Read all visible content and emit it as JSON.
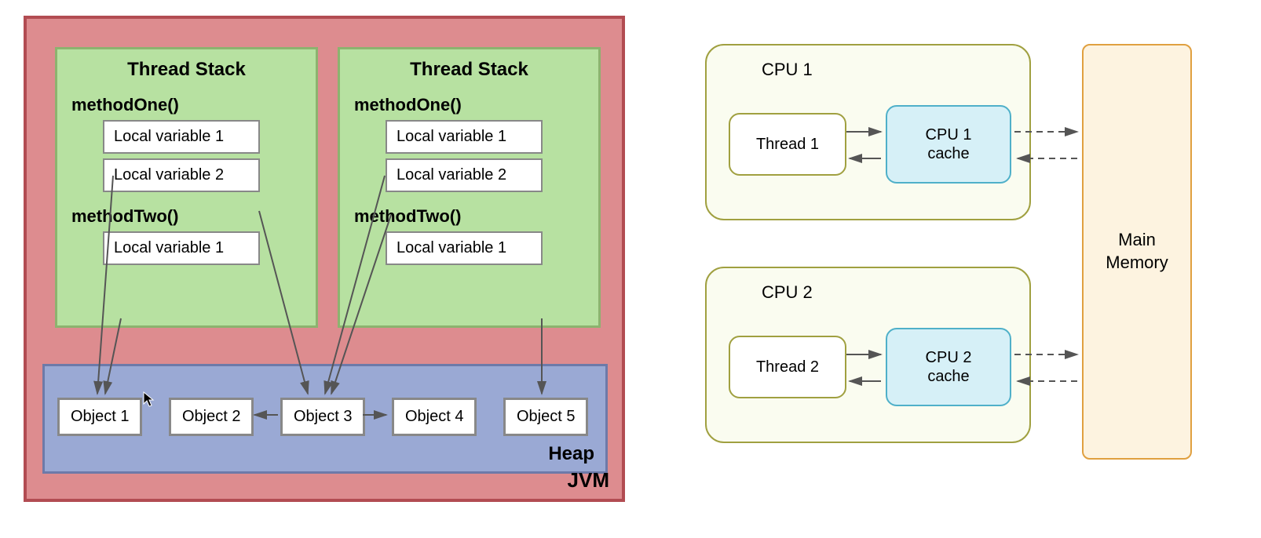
{
  "jvm": {
    "label": "JVM",
    "threadStacks": [
      {
        "title": "Thread Stack",
        "methodOneLabel": "methodOne()",
        "methodTwoLabel": "methodTwo()",
        "lv1": "Local variable 1",
        "lv2": "Local variable 2",
        "m2lv1": "Local variable 1"
      },
      {
        "title": "Thread Stack",
        "methodOneLabel": "methodOne()",
        "methodTwoLabel": "methodTwo()",
        "lv1": "Local variable 1",
        "lv2": "Local variable 2",
        "m2lv1": "Local variable 1"
      }
    ],
    "heap": {
      "label": "Heap",
      "objects": [
        "Object 1",
        "Object 2",
        "Object 3",
        "Object 4",
        "Object 5"
      ]
    }
  },
  "hardware": {
    "cpu1": {
      "title": "CPU 1",
      "thread": "Thread 1",
      "cache": "CPU 1 cache"
    },
    "cpu2": {
      "title": "CPU 2",
      "thread": "Thread 2",
      "cache": "CPU 2 cache"
    },
    "mainMemory": "Main Memory"
  }
}
